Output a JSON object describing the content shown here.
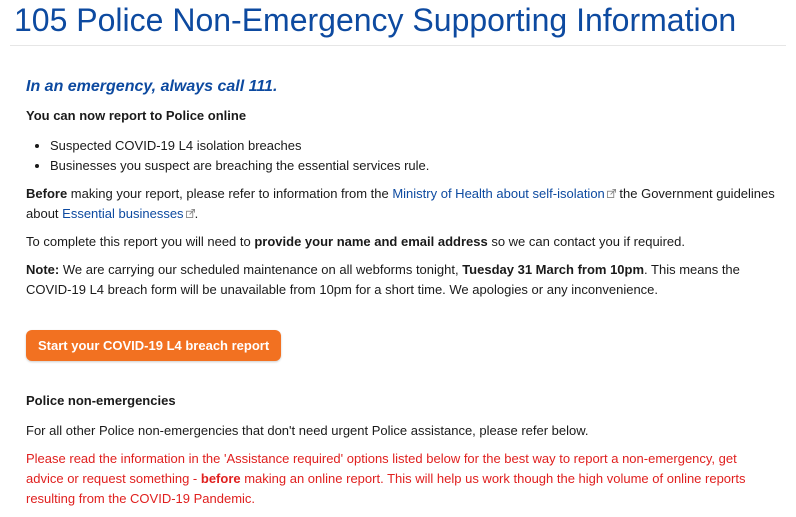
{
  "page": {
    "title": "105 Police Non-Emergency Supporting Information"
  },
  "main": {
    "emergency_text": "In an emergency, always call 111.",
    "report_online_heading": "You can now report to Police online",
    "report_items": [
      "Suspected COVID-19 L4 isolation breaches",
      "Businesses you suspect are breaching the essential services rule."
    ],
    "before_para": {
      "before_bold": "Before",
      "text1": " making your report, please refer to information from the ",
      "link1": "Ministry of Health about self-isolation",
      "text2": " the Government guidelines about ",
      "link2": "Essential businesses",
      "text3": "."
    },
    "complete_para": {
      "text1": "To complete this report you will need to ",
      "bold": "provide your name and email address",
      "text2": " so we can contact you if required."
    },
    "note_para": {
      "note_bold": "Note:",
      "text1": " We are carrying our scheduled maintenance on all webforms tonight, ",
      "date_bold": "Tuesday 31 March from 10pm",
      "text2": ". This means the COVID-19 L4 breach form will be unavailable from 10pm for a short time. We apologies or any inconvenience."
    },
    "cta_label": "Start your COVID-19 L4 breach report",
    "non_emergency_heading": "Police non-emergencies",
    "non_emergency_text": "For all other Police non-emergencies that don't need urgent Police assistance, please refer below.",
    "warning_para": {
      "text1": "Please read the information in the 'Assistance required' options listed below for the best way to report a non-emergency, get advice or request something - ",
      "bold": "before",
      "text2": " making an online report. This will help us work though the high volume of online reports resulting from the COVID-19 Pandemic."
    }
  },
  "colors": {
    "title_blue": "#0d4aa0",
    "link_blue": "#0d4aa0",
    "cta_orange": "#f27121",
    "warning_red": "#e0201f"
  },
  "icons": {
    "external_link": "external-link-icon"
  }
}
